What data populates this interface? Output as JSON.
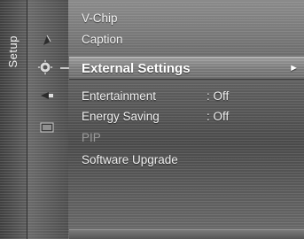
{
  "side_tab": {
    "label": "Setup"
  },
  "icons": [
    "picture-icon",
    "sound-icon",
    "setup-gear-icon",
    "input-icon",
    "application-icon"
  ],
  "menu": {
    "items": [
      {
        "label": "V-Chip",
        "value": "",
        "state": "normal"
      },
      {
        "label": "Caption",
        "value": "",
        "state": "normal"
      },
      {
        "label": "External Settings",
        "value": "",
        "state": "selected",
        "arrow": "►"
      },
      {
        "label": "Entertainment",
        "value": ": Off",
        "state": "normal"
      },
      {
        "label": "Energy Saving",
        "value": ": Off",
        "state": "normal"
      },
      {
        "label": "PIP",
        "value": "",
        "state": "disabled"
      },
      {
        "label": "Software Upgrade",
        "value": "",
        "state": "normal"
      }
    ]
  },
  "colors": {
    "selected_bg": "#8a8a8a",
    "text": "#f0f0f0",
    "disabled_text": "#9a9a9a"
  }
}
